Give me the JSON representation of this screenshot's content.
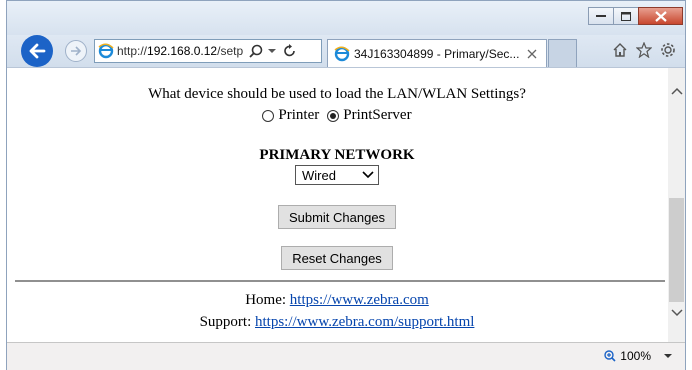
{
  "browser": {
    "address": {
      "prefix": "http://",
      "host": "192.168.0.12",
      "suffix": "/setp"
    },
    "tab_title": "34J163304899 - Primary/Sec...",
    "zoom": "100%"
  },
  "page": {
    "question": "What device should be used to load the LAN/WLAN Settings?",
    "radio_printer": "Printer",
    "radio_printserver": "PrintServer",
    "selected_radio": "PrintServer",
    "heading": "PRIMARY NETWORK",
    "network_select": "Wired",
    "submit_label": "Submit Changes",
    "reset_label": "Reset Changes",
    "home_label": "Home:",
    "home_link": "https://www.zebra.com",
    "support_label": "Support:",
    "support_link": "https://www.zebra.com/support.html"
  },
  "colors": {
    "back_button": "#1c63c7",
    "link": "#0645ad",
    "close_button": "#c8472f"
  }
}
